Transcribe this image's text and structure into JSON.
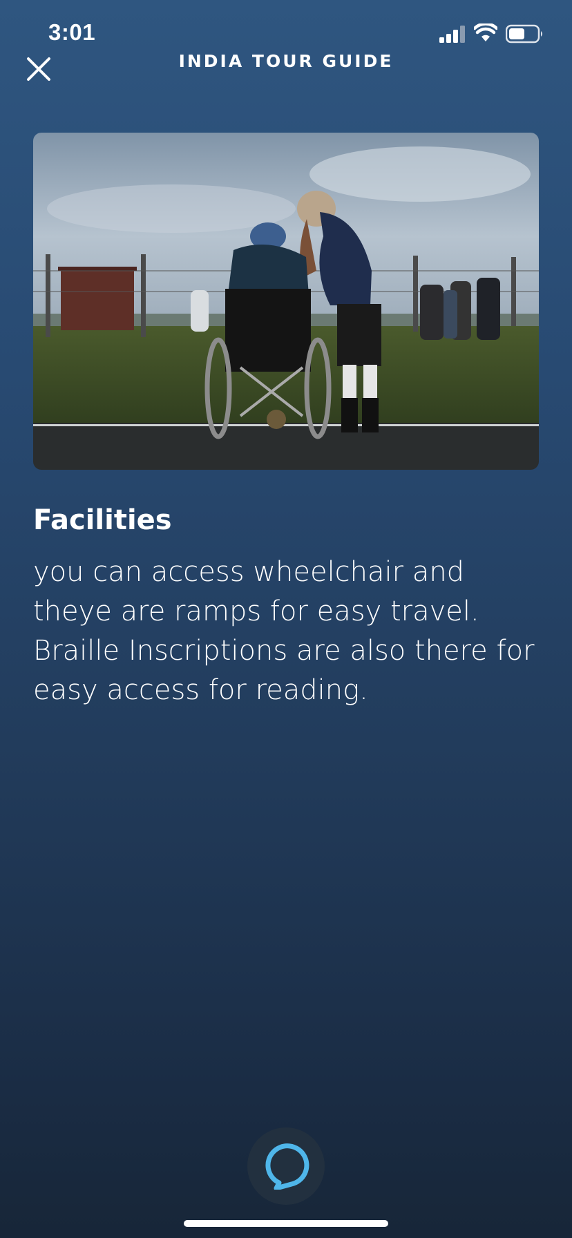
{
  "status_bar": {
    "time": "3:01",
    "icons": [
      "cellular-signal-icon",
      "wifi-icon",
      "battery-icon"
    ]
  },
  "header": {
    "title": "INDIA TOUR GUIDE",
    "close_icon": "close-icon"
  },
  "content": {
    "image_icon": "photo-wheelchair-scene",
    "heading": "Facilities",
    "body": "you can access wheelchair and theye are ramps for easy travel. Braille Inscriptions are also there for easy access for reading."
  },
  "footer": {
    "alexa_icon": "alexa-ring-icon"
  },
  "colors": {
    "background_top": "#2f5680",
    "background_bottom": "#172638",
    "alexa_ring": "#4fb6ea",
    "text": "#ffffff"
  }
}
